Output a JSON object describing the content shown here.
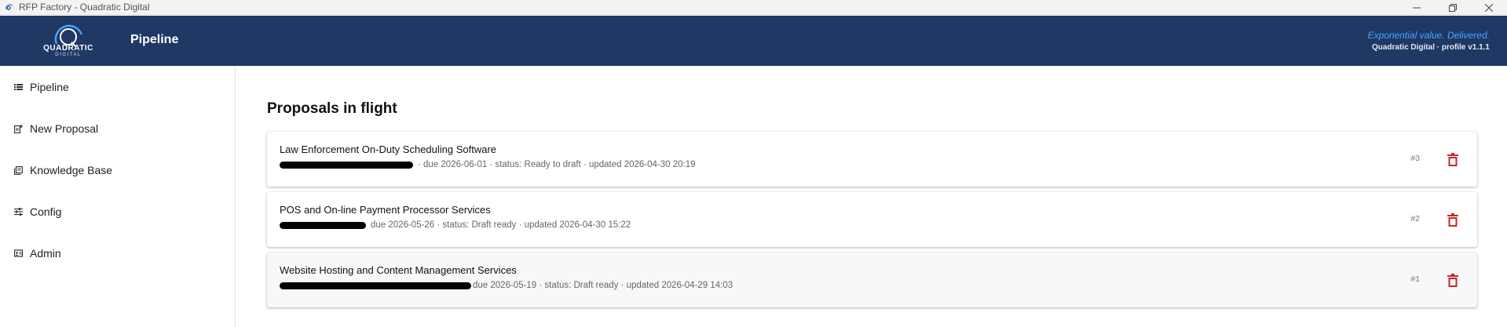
{
  "window": {
    "title": "RFP Factory - Quadratic Digital",
    "controls": [
      "minimize-icon",
      "restore-icon",
      "close-icon"
    ]
  },
  "header": {
    "logo_name": "QUADRATIC",
    "logo_sub": "DIGITAL",
    "page_title": "Pipeline",
    "tagline": "Exponential value. Delivered.",
    "profile": "Quadratic Digital · profile v1.1.1"
  },
  "sidebar": {
    "items": [
      {
        "label": "Pipeline",
        "icon": "list-icon"
      },
      {
        "label": "New Proposal",
        "icon": "document-add-icon"
      },
      {
        "label": "Knowledge Base",
        "icon": "library-icon"
      },
      {
        "label": "Config",
        "icon": "sliders-icon"
      },
      {
        "label": "Admin",
        "icon": "admin-card-icon"
      }
    ]
  },
  "main": {
    "section_title": "Proposals in flight",
    "proposals": [
      {
        "title": "Law Enforcement On-Duty Scheduling Software",
        "meta": "· due 2026-06-01 · status: Ready to draft · updated 2026-04-30 20:19",
        "number": "#3"
      },
      {
        "title": "POS and On-line Payment Processor Services",
        "meta": "due 2026-05-26 · status: Draft ready · updated 2026-04-30 15:22",
        "number": "#2"
      },
      {
        "title": "Website Hosting and Content Management Services",
        "meta": "due 2026-05-19 · status: Draft ready · updated 2026-04-29 14:03",
        "number": "#1"
      }
    ]
  },
  "colors": {
    "header_bg": "#1f3864",
    "tagline": "#4aa3ff",
    "delete": "#c62828"
  }
}
